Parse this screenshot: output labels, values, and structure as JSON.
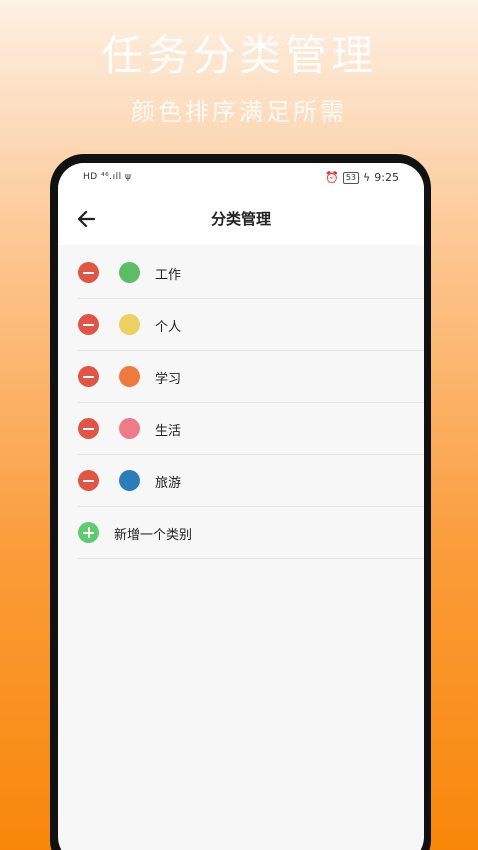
{
  "promo": {
    "title": "任务分类管理",
    "subtitle": "颜色排序满足所需"
  },
  "status_bar": {
    "left": "HD ⁴⁶.ıll ψ",
    "alarm_icon": "alarm-icon",
    "battery": "53",
    "time": "9:25"
  },
  "nav": {
    "back_icon": "arrow-left-icon",
    "title": "分类管理"
  },
  "categories": [
    {
      "label": "工作",
      "color": "#5cbd67"
    },
    {
      "label": "个人",
      "color": "#ecd062"
    },
    {
      "label": "学习",
      "color": "#f07a3d"
    },
    {
      "label": "生活",
      "color": "#ee7a8a"
    },
    {
      "label": "旅游",
      "color": "#2a7db8"
    }
  ],
  "add_category": {
    "icon": "plus-circle-icon",
    "label": "新增一个类别"
  }
}
